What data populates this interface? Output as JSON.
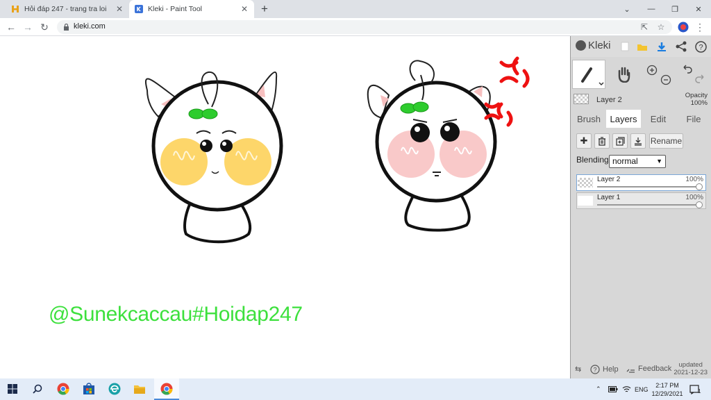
{
  "browser": {
    "tabs": [
      {
        "title": "Hỏi đáp 247 - trang tra loi",
        "active": false
      },
      {
        "title": "Kleki - Paint Tool",
        "active": true
      }
    ],
    "new_tab_label": "+",
    "url": "kleki.com"
  },
  "canvas": {
    "watermark": "@Sunekcaccau#Hoidap247",
    "colors": {
      "watermark": "#3de03d",
      "angry_mark": "#ee1111",
      "cheek_yellow": "#fdd66a",
      "cheek_pink": "#f9c9c9",
      "sprout": "#2ecc2e"
    }
  },
  "kleki": {
    "logo": "Kleki",
    "current_layer": {
      "name": "Layer 2",
      "opacity_label": "Opacity",
      "opacity_value": "100%"
    },
    "tabs": [
      "Brush",
      "Layers",
      "Edit",
      "File"
    ],
    "selected_tab": "Layers",
    "rename_label": "Rename",
    "blending_label": "Blending",
    "blending_value": "normal",
    "layers": [
      {
        "name": "Layer 2",
        "opacity": "100%",
        "selected": true
      },
      {
        "name": "Layer 1",
        "opacity": "100%",
        "selected": false
      }
    ],
    "help_label": "Help",
    "feedback_label": "Feedback",
    "updated_label": "updated",
    "updated_date": "2021-12-23"
  },
  "taskbar": {
    "language": "ENG",
    "time": "2:17 PM",
    "date": "12/29/2021",
    "notification_count": "1"
  }
}
